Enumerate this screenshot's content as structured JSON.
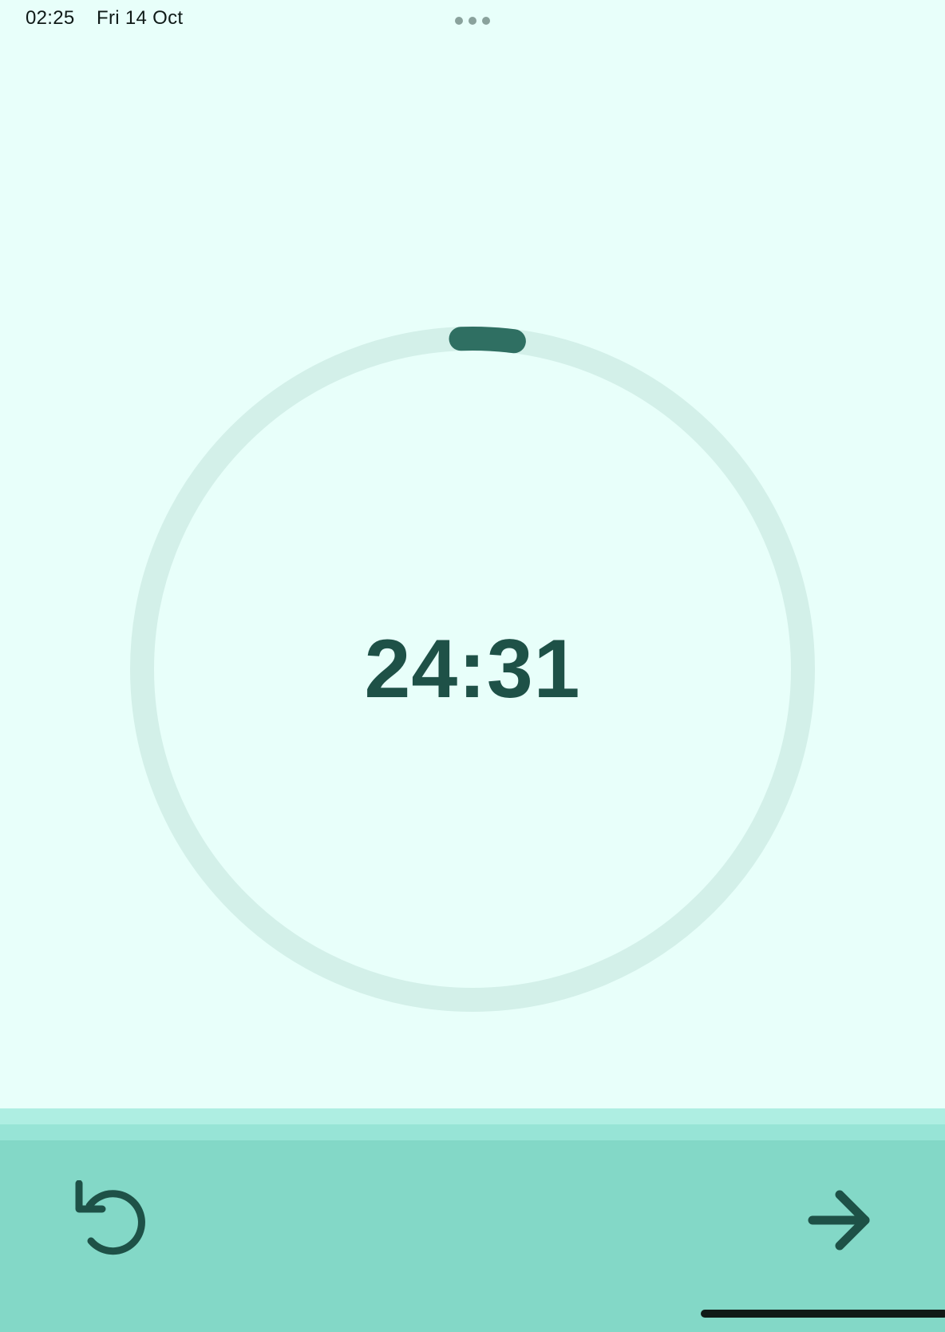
{
  "status_bar": {
    "time": "02:25",
    "date": "Fri 14 Oct",
    "multitask_icon": "ellipsis-dots-icon"
  },
  "timer": {
    "display": "24:31",
    "progress_fraction": 0.02,
    "track_color": "#d3f0e9",
    "progress_color": "#2f6f62",
    "text_color": "#1e5147"
  },
  "controls": {
    "reset_icon": "reset-icon",
    "next_icon": "arrow-right-icon",
    "icon_color": "#1e5147"
  },
  "colors": {
    "background": "#e8fffa",
    "bottom_bar": "#83d8c7"
  }
}
